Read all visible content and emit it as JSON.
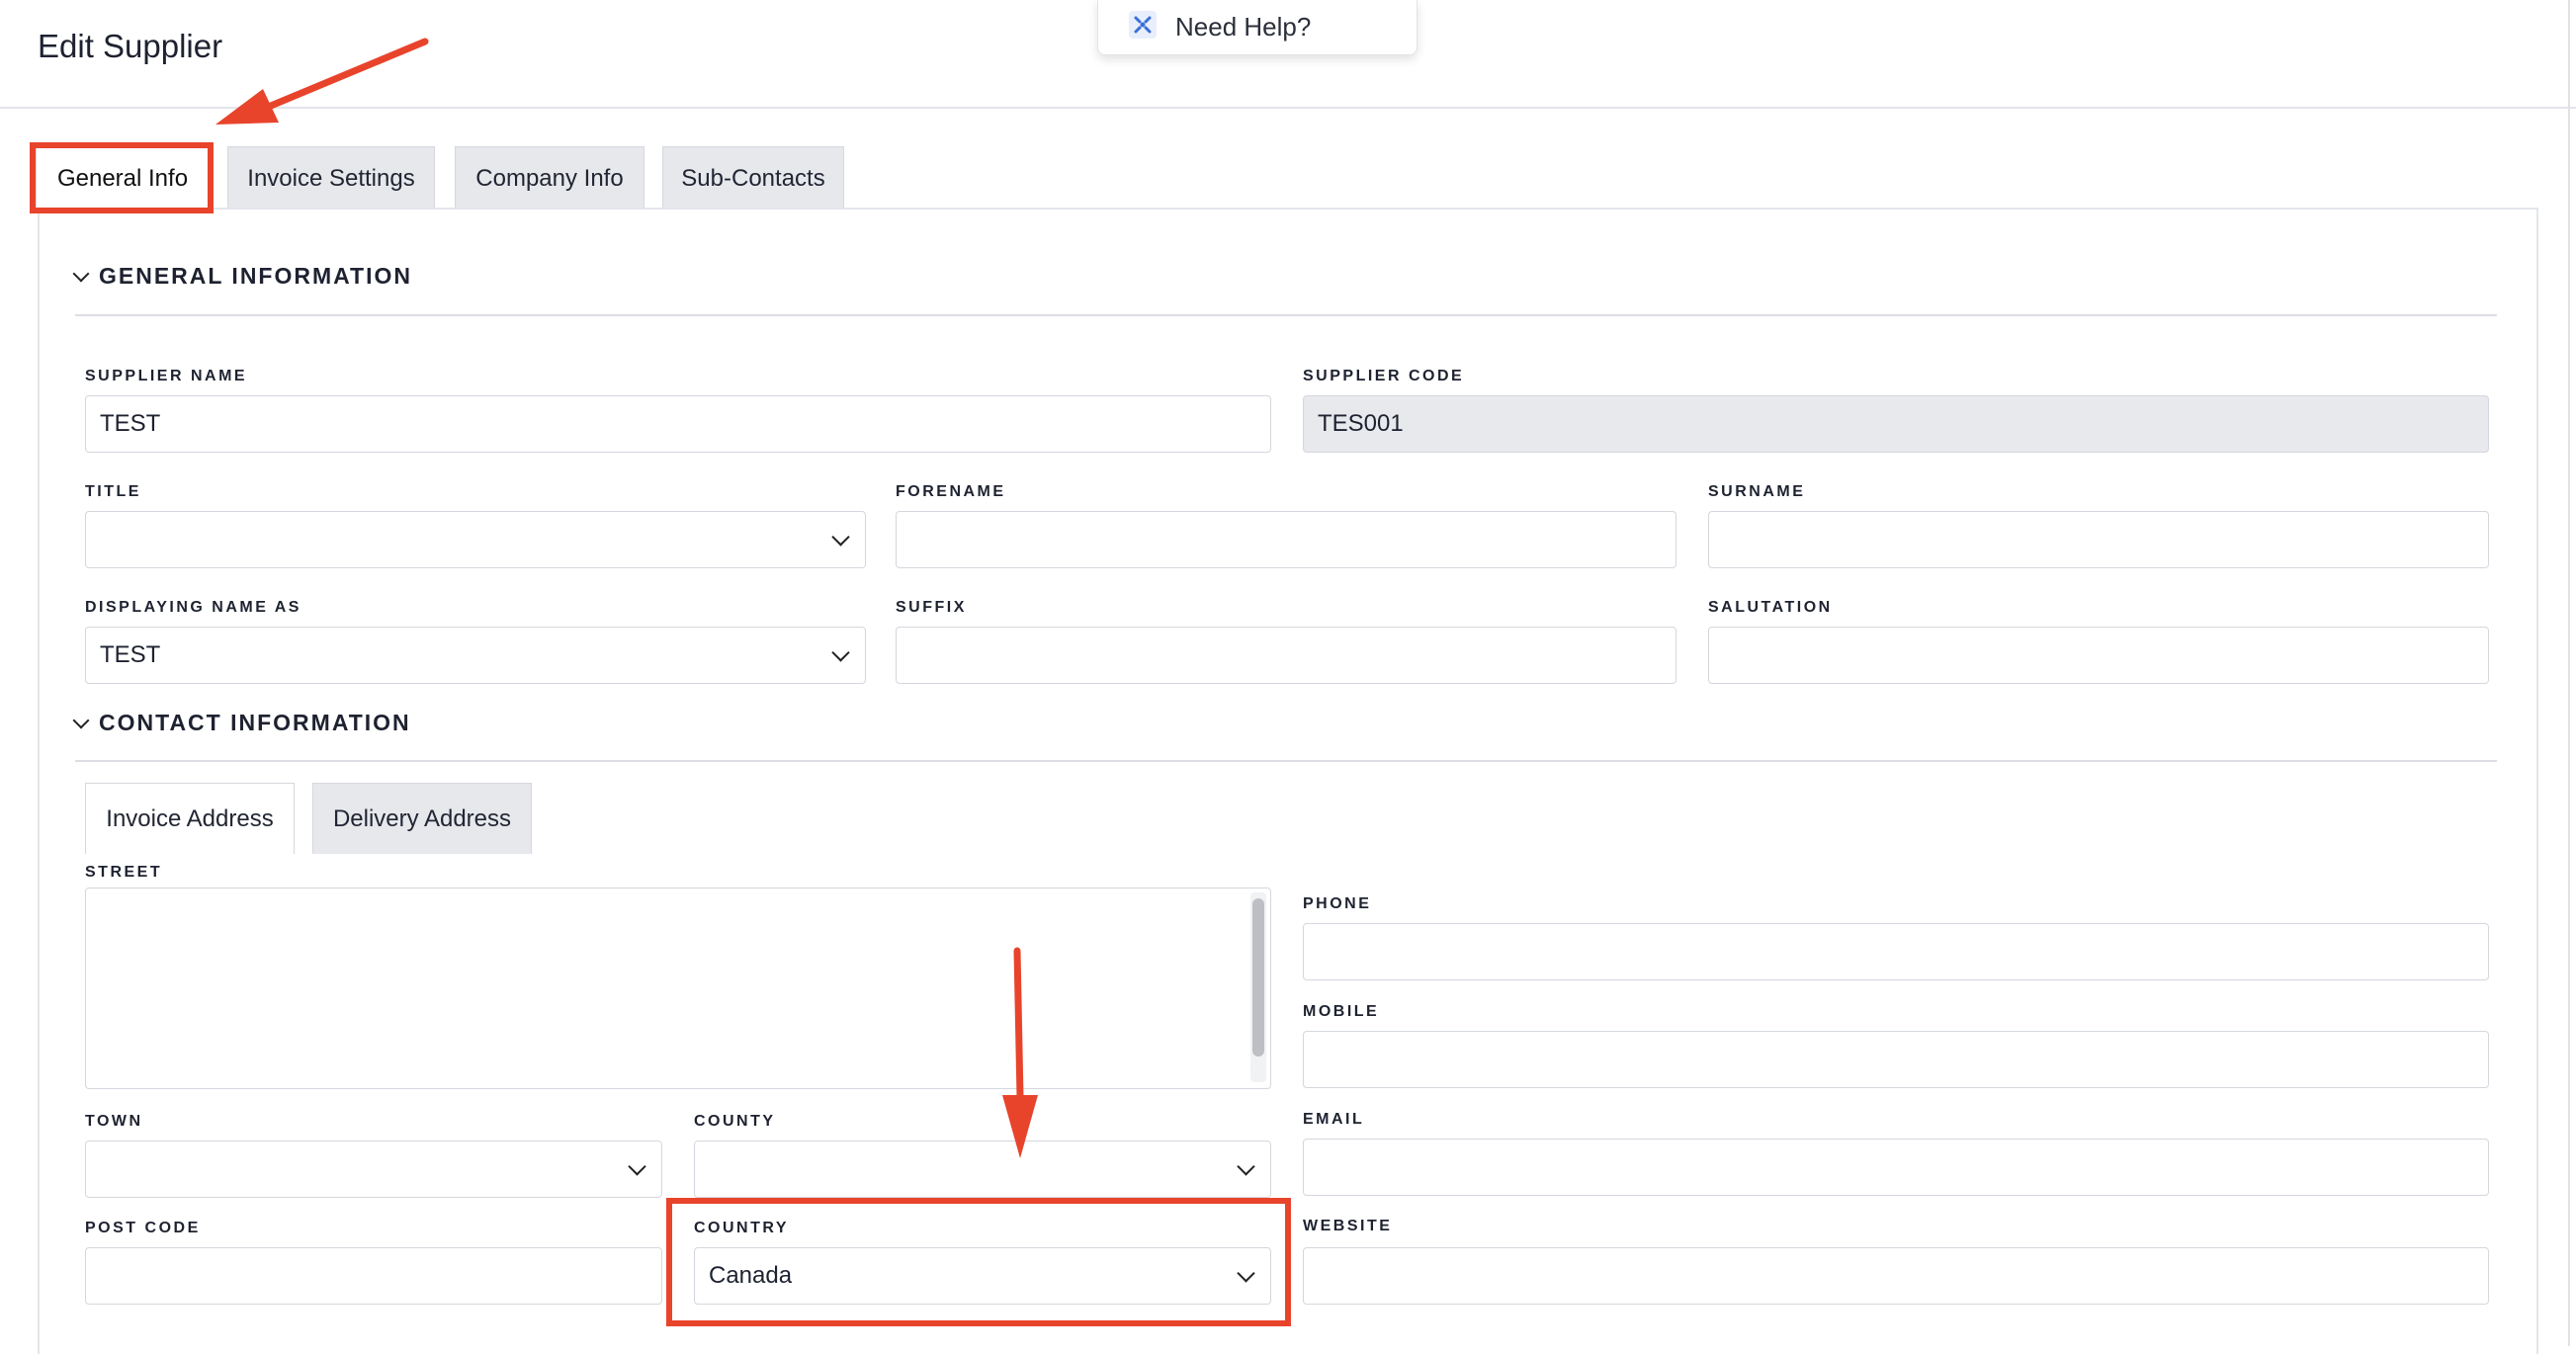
{
  "page": {
    "title": "Edit Supplier"
  },
  "help": {
    "label": "Need Help?",
    "icon": "help-grid-icon"
  },
  "tabs": [
    "General Info",
    "Invoice Settings",
    "Company Info",
    "Sub-Contacts"
  ],
  "sections": {
    "general": "GENERAL INFORMATION",
    "contact": "CONTACT INFORMATION"
  },
  "fields": {
    "supplier_name": {
      "label": "SUPPLIER NAME",
      "value": "TEST"
    },
    "supplier_code": {
      "label": "SUPPLIER CODE",
      "value": "TES001"
    },
    "title": {
      "label": "TITLE",
      "value": ""
    },
    "forename": {
      "label": "FORENAME",
      "value": ""
    },
    "surname": {
      "label": "SURNAME",
      "value": ""
    },
    "displaying_name_as": {
      "label": "DISPLAYING NAME AS",
      "value": "TEST"
    },
    "suffix": {
      "label": "SUFFIX",
      "value": ""
    },
    "salutation": {
      "label": "SALUTATION",
      "value": ""
    },
    "street": {
      "label": "STREET",
      "value": ""
    },
    "town": {
      "label": "TOWN",
      "value": ""
    },
    "county": {
      "label": "COUNTY",
      "value": ""
    },
    "post_code": {
      "label": "POST CODE",
      "value": ""
    },
    "country": {
      "label": "COUNTRY",
      "value": "Canada"
    },
    "phone": {
      "label": "PHONE",
      "value": ""
    },
    "mobile": {
      "label": "MOBILE",
      "value": ""
    },
    "email": {
      "label": "EMAIL",
      "value": ""
    },
    "website": {
      "label": "WEBSITE",
      "value": ""
    }
  },
  "address_tabs": [
    "Invoice Address",
    "Delivery Address"
  ],
  "colors": {
    "annotation": "#e8442c",
    "readonly_bg": "#e8e9ec",
    "tab_inactive_bg": "#e7e8ec"
  }
}
